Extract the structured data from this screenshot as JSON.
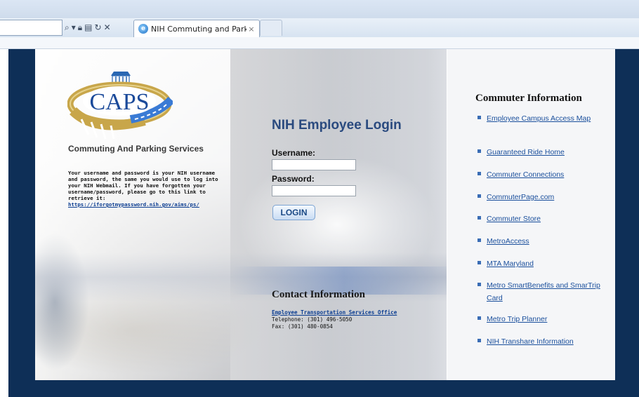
{
  "browser": {
    "tab_title": "NIH Commuting and Parki...",
    "tab_close": "×",
    "toolbar_icons": [
      "search-icon",
      "dropdown-icon",
      "lock-icon",
      "compat-icon",
      "refresh-icon",
      "stop-icon"
    ]
  },
  "logo": {
    "text": "CAPS",
    "subtitle": "Commuting And Parking Services"
  },
  "info": {
    "text": "Your username and password is your NIH username and password, the same you would use to log into your NIH Webmail.  If you have forgotten your username/password, please go to this link to retrieve it:",
    "link": "https://iforgotmypassword.nih.gov/aims/ps/"
  },
  "login": {
    "title": "NIH Employee Login",
    "username_label": "Username:",
    "username_value": "",
    "password_label": "Password:",
    "password_value": "",
    "button": "LOGIN"
  },
  "contact": {
    "title": "Contact Information",
    "office_link": "Employee Transportation Services Office",
    "telephone": "Telephone: (301) 496-5050",
    "fax": "Fax: (301) 480-0854"
  },
  "commuter": {
    "title": "Commuter Information",
    "links": [
      {
        "label": "Employee Campus Access Map"
      },
      {
        "label": "Guaranteed Ride Home"
      },
      {
        "label": "Commuter Connections"
      },
      {
        "label": "CommuterPage.com"
      },
      {
        "label": "Commuter Store"
      },
      {
        "label": "MetroAccess"
      },
      {
        "label": "MTA Maryland"
      },
      {
        "label": "Metro SmartBenefits and SmarTrip Card"
      },
      {
        "label": "Metro Trip Planner"
      },
      {
        "label": "NIH Transhare Information"
      }
    ]
  },
  "colors": {
    "frame": "#0e2f57",
    "link": "#1a4f9c",
    "title": "#2a4a7f"
  }
}
